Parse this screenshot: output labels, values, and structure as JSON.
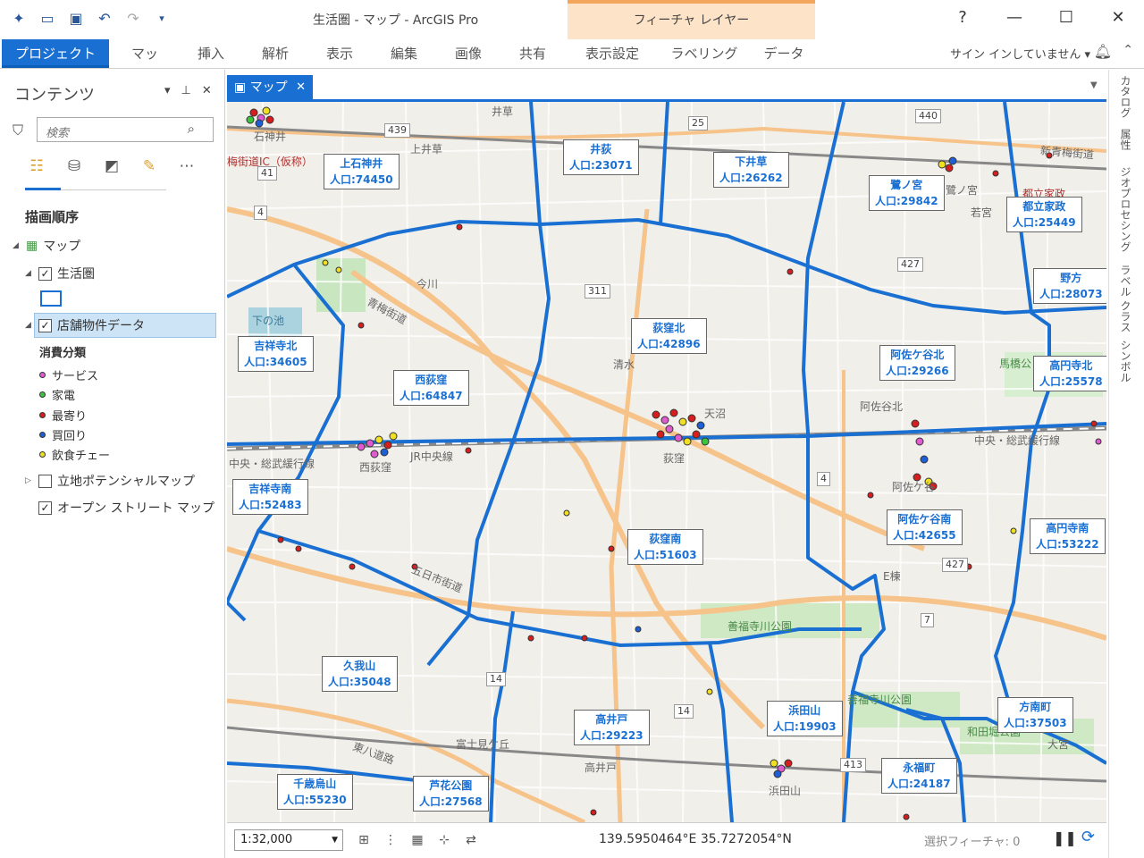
{
  "window": {
    "title": "生活圏 - マップ - ArcGIS Pro",
    "context_header": "フィーチャ レイヤー",
    "help": "?",
    "minimize": "—",
    "maximize": "☐",
    "close": "✕"
  },
  "ribbon": {
    "tabs": [
      "プロジェクト",
      "マップ",
      "挿入",
      "解析",
      "表示",
      "編集",
      "画像",
      "共有",
      "表示設定",
      "ラベリング",
      "データ"
    ],
    "signin": "サイン インしていません ▾"
  },
  "contents": {
    "title": "コンテンツ",
    "search_placeholder": "検索",
    "draw_order": "描画順序",
    "layers": {
      "map": "マップ",
      "seikatsuken": "生活圏",
      "stores": "店舗物件データ",
      "potential": "立地ポテンシャルマップ",
      "osm": "オープン ストリート マップ"
    },
    "legend_title": "消費分類",
    "legend": [
      {
        "label": "サービス",
        "color": "#e05bd0"
      },
      {
        "label": "家電",
        "color": "#3cc43c"
      },
      {
        "label": "最寄り",
        "color": "#d61e1e"
      },
      {
        "label": "買回り",
        "color": "#1e5fd6"
      },
      {
        "label": "飲食チェー",
        "color": "#f0e020"
      }
    ]
  },
  "map_tab": {
    "label": "マップ",
    "close": "✕"
  },
  "side_tabs": [
    "カタログ",
    "属性",
    "ジオプロセシング",
    "ラベル クラス",
    "シンボル"
  ],
  "areas": [
    {
      "name": "上石神井",
      "pop": "人口:74450"
    },
    {
      "name": "井荻",
      "pop": "人口:23071"
    },
    {
      "name": "下井草",
      "pop": "人口:26262"
    },
    {
      "name": "鷺ノ宮",
      "pop": "人口:29842"
    },
    {
      "name": "都立家政",
      "pop": "人口:25449"
    },
    {
      "name": "野方",
      "pop": "人口:28073"
    },
    {
      "name": "吉祥寺北",
      "pop": "人口:34605"
    },
    {
      "name": "西荻窪",
      "pop": "人口:64847"
    },
    {
      "name": "荻窪北",
      "pop": "人口:42896"
    },
    {
      "name": "阿佐ケ谷北",
      "pop": "人口:29266"
    },
    {
      "name": "高円寺北",
      "pop": "人口:25578"
    },
    {
      "name": "吉祥寺南",
      "pop": "人口:52483"
    },
    {
      "name": "荻窪南",
      "pop": "人口:51603"
    },
    {
      "name": "阿佐ケ谷南",
      "pop": "人口:42655"
    },
    {
      "name": "高円寺南",
      "pop": "人口:53222"
    },
    {
      "name": "久我山",
      "pop": "人口:35048"
    },
    {
      "name": "高井戸",
      "pop": "人口:29223"
    },
    {
      "name": "浜田山",
      "pop": "人口:19903"
    },
    {
      "name": "方南町",
      "pop": "人口:37503"
    },
    {
      "name": "永福町",
      "pop": "人口:24187"
    },
    {
      "name": "千歳烏山",
      "pop": "人口:55230"
    },
    {
      "name": "芦花公園",
      "pop": "人口:27568"
    }
  ],
  "places": [
    "石神井",
    "上井草",
    "今川",
    "清水",
    "天沼",
    "荻窪",
    "西荻窪",
    "JR中央線",
    "阿佐谷北",
    "阿佐ケ谷",
    "中央・総武緩行線",
    "青梅街道",
    "五日市街道",
    "善福寺川公園",
    "善福寺川公園",
    "和田堀公園",
    "大宮",
    "浜田山",
    "高井戸",
    "富士見ケ丘",
    "東八道路",
    "馬橋公",
    "下の池",
    "若宮",
    "鷺ノ宮",
    "新青梅街道",
    "梅街道IC（仮称）",
    "井草",
    "都立家政",
    "E棟",
    "中央・総武緩行線"
  ],
  "shields": [
    "439",
    "311",
    "25",
    "440",
    "427",
    "4",
    "14",
    "7",
    "427",
    "413",
    "14",
    "4",
    "41"
  ],
  "status": {
    "scale": "1:32,000",
    "coords": "139.5950464°E 35.7272054°N",
    "selected": "選択フィーチャ: 0"
  }
}
